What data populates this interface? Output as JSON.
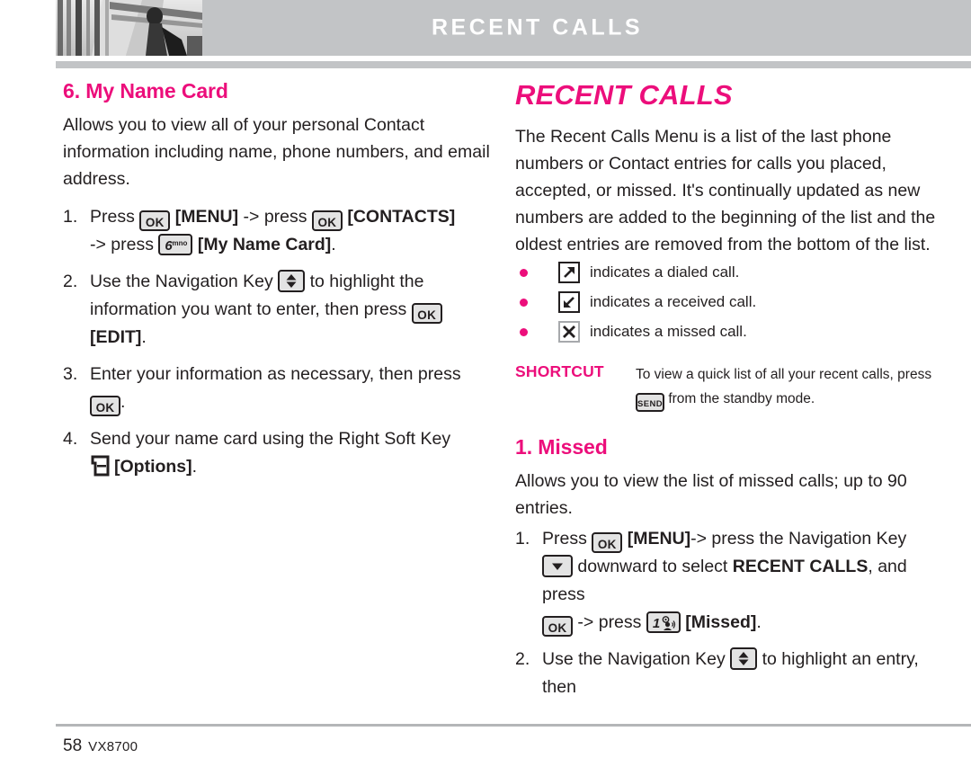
{
  "header": {
    "title": "RECENT CALLS",
    "photo_alt": "architecture-photo"
  },
  "left_column": {
    "heading": "6. My Name Card",
    "intro": "Allows you to view all of your personal Contact information including name, phone numbers, and email address.",
    "steps": [
      {
        "num": "1.",
        "p1": "Press",
        "key1": "OK",
        "p2": "[MENU]",
        "p3": "-> press",
        "key2": "OK",
        "p4": "[CONTACTS]",
        "p5": "-> press",
        "key3_digit": "6",
        "key3_sub": "mno",
        "p6": "[My Name Card]",
        "p7": "."
      },
      {
        "num": "2.",
        "p1": "Use the Navigation Key",
        "key1": "nav-updown",
        "p2": "to highlight the information you want to enter, then press",
        "key2": "OK",
        "p3": "[EDIT]",
        "p4": "."
      },
      {
        "num": "3.",
        "p1": "Enter your information as necessary, then press",
        "key1": "OK",
        "p2": "."
      },
      {
        "num": "4.",
        "p1": "Send your name card using the Right Soft Key",
        "key1": "right-soft-key",
        "p2": "[Options]",
        "p3": "."
      }
    ]
  },
  "right_column": {
    "heading": "RECENT CALLS",
    "intro": "The Recent Calls Menu is a list of the last phone numbers or Contact entries for calls you placed, accepted, or missed. It's continually updated as new numbers are added to the beginning of the list and the oldest entries are removed from the bottom of the list.",
    "bullets": [
      {
        "icon": "dialed-call-icon",
        "text": "indicates a dialed call."
      },
      {
        "icon": "received-call-icon",
        "text": "indicates a received call."
      },
      {
        "icon": "missed-call-icon",
        "text": "indicates a missed call."
      }
    ],
    "shortcut": {
      "label": "SHORTCUT",
      "text_before": "To view a quick list of all your recent calls, press",
      "key": "SEND",
      "text_after": "from the standby mode."
    },
    "subsection": {
      "heading": "1. Missed",
      "intro": "Allows you to view the list of missed calls; up to 90 entries.",
      "steps": [
        {
          "num": "1.",
          "p1": "Press",
          "key1": "OK",
          "p2": "[MENU]",
          "p3": "-> press the Navigation Key",
          "key2": "nav-down",
          "p4": "downward to select",
          "p5": "RECENT CALLS",
          "p6": ", and press",
          "key3": "OK",
          "p7": "-> press",
          "key4_digit": "1",
          "p8": "[Missed]",
          "p9": "."
        },
        {
          "num": "2.",
          "p1": "Use the Navigation Key",
          "key1": "nav-updown",
          "p2": "to highlight an entry, then"
        }
      ]
    }
  },
  "footer": {
    "page_number": "58",
    "model": "VX8700"
  },
  "colors": {
    "accent_pink": "#ec0e7b",
    "header_gray": "#c2c4c6",
    "text": "#231f20"
  }
}
